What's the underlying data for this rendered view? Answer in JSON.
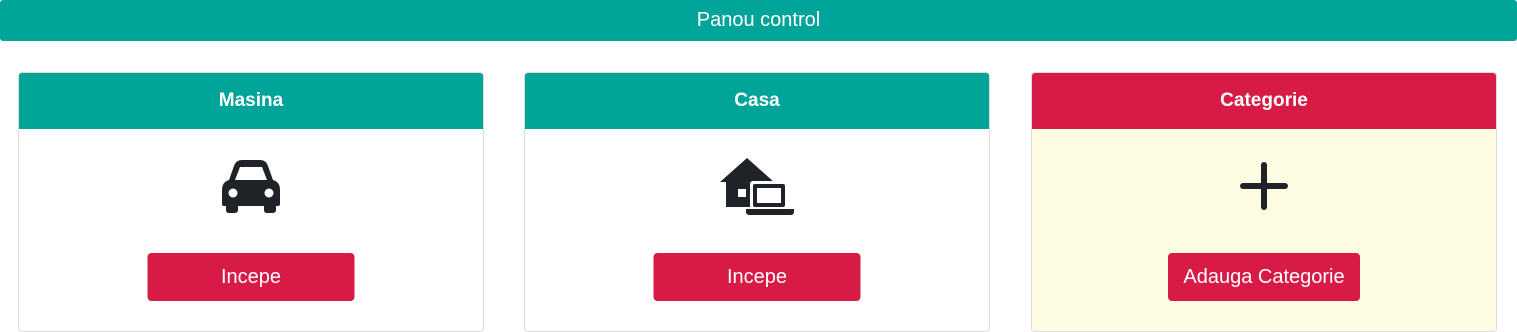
{
  "header": {
    "title": "Panou control"
  },
  "cards": [
    {
      "title": "Masina",
      "icon": "car-icon",
      "button_label": "Incepe"
    },
    {
      "title": "Casa",
      "icon": "house-laptop-icon",
      "button_label": "Incepe"
    },
    {
      "title": "Categorie",
      "icon": "plus-icon",
      "button_label": "Adauga Categorie"
    }
  ],
  "colors": {
    "primary": "#00a499",
    "accent": "#d81a46",
    "highlight_bg": "#fefde3",
    "icon": "#1f2328"
  }
}
